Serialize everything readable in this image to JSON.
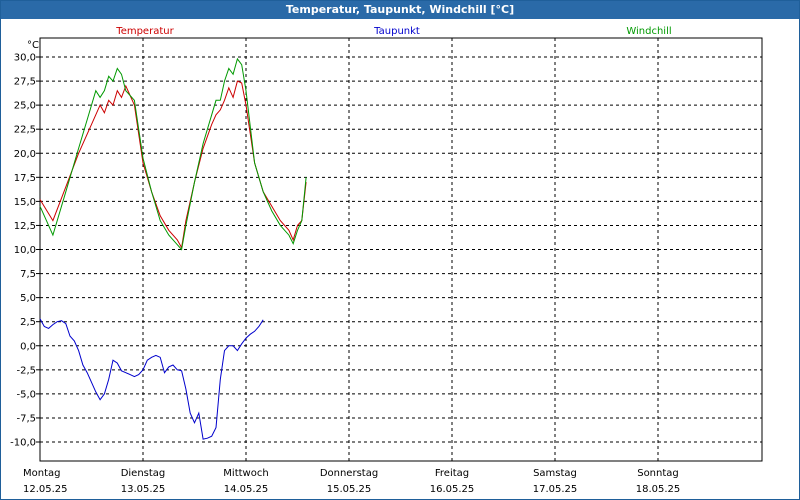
{
  "window": {
    "title": "Temperatur, Taupunkt, Windchill [°C]"
  },
  "chart_data": {
    "type": "line",
    "title": "Temperatur, Taupunkt, Windchill [°C]",
    "yunit": "°C",
    "ylim": [
      -12.5,
      32.5
    ],
    "yticks": [
      "30,0",
      "27,5",
      "25,0",
      "22,5",
      "20,0",
      "17,5",
      "15,0",
      "12,5",
      "10,0",
      "7,5",
      "5,0",
      "2,5",
      "0,0",
      "-2,5",
      "-5,0",
      "-7,5",
      "-10,0"
    ],
    "grid": true,
    "day_labels": [
      {
        "day": "Montag",
        "date": "12.05.25"
      },
      {
        "day": "Dienstag",
        "date": "13.05.25"
      },
      {
        "day": "Mittwoch",
        "date": "14.05.25"
      },
      {
        "day": "Donnerstag",
        "date": "15.05.25"
      },
      {
        "day": "Freitag",
        "date": "16.05.25"
      },
      {
        "day": "Samstag",
        "date": "17.05.25"
      },
      {
        "day": "Sonntag",
        "date": "18.05.25"
      }
    ],
    "series": [
      {
        "name": "Temperatur",
        "color": "#cc0000",
        "points": [
          [
            0,
            15.2
          ],
          [
            3,
            13.0
          ],
          [
            6,
            16.5
          ],
          [
            9,
            20.0
          ],
          [
            12,
            23.0
          ],
          [
            14,
            25.0
          ],
          [
            15,
            24.2
          ],
          [
            16,
            25.5
          ],
          [
            17,
            25.0
          ],
          [
            18,
            26.5
          ],
          [
            19,
            25.8
          ],
          [
            20,
            27.0
          ],
          [
            21,
            26.0
          ],
          [
            22,
            25.0
          ],
          [
            23,
            22.0
          ],
          [
            24,
            19.0
          ],
          [
            26,
            16.0
          ],
          [
            28,
            13.5
          ],
          [
            30,
            12.0
          ],
          [
            32,
            11.0
          ],
          [
            33,
            10.2
          ],
          [
            34,
            13.0
          ],
          [
            36,
            17.0
          ],
          [
            38,
            20.5
          ],
          [
            40,
            23.0
          ],
          [
            41,
            24.0
          ],
          [
            42,
            24.5
          ],
          [
            43,
            25.5
          ],
          [
            44,
            26.8
          ],
          [
            45,
            25.8
          ],
          [
            46,
            27.5
          ],
          [
            47,
            27.3
          ],
          [
            48,
            25.0
          ],
          [
            50,
            19.0
          ],
          [
            52,
            16.0
          ],
          [
            54,
            14.5
          ],
          [
            56,
            13.0
          ],
          [
            58,
            12.0
          ],
          [
            59,
            11.0
          ],
          [
            60,
            12.5
          ],
          [
            61,
            13.0
          ],
          [
            62,
            17.0
          ]
        ]
      },
      {
        "name": "Taupunkt",
        "color": "#0000cc",
        "points": [
          [
            0,
            2.8
          ],
          [
            1,
            2.0
          ],
          [
            2,
            1.8
          ],
          [
            3,
            2.2
          ],
          [
            4,
            2.5
          ],
          [
            5,
            2.6
          ],
          [
            6,
            2.3
          ],
          [
            7,
            1.0
          ],
          [
            8,
            0.5
          ],
          [
            9,
            -0.5
          ],
          [
            10,
            -2.0
          ],
          [
            11,
            -2.8
          ],
          [
            12,
            -3.8
          ],
          [
            13,
            -4.8
          ],
          [
            14,
            -5.6
          ],
          [
            15,
            -5.0
          ],
          [
            16,
            -3.5
          ],
          [
            17,
            -1.5
          ],
          [
            18,
            -1.8
          ],
          [
            19,
            -2.6
          ],
          [
            20,
            -2.8
          ],
          [
            21,
            -3.0
          ],
          [
            22,
            -3.2
          ],
          [
            23,
            -3.0
          ],
          [
            24,
            -2.5
          ],
          [
            25,
            -1.5
          ],
          [
            26,
            -1.2
          ],
          [
            27,
            -1.0
          ],
          [
            28,
            -1.2
          ],
          [
            29,
            -2.8
          ],
          [
            30,
            -2.2
          ],
          [
            31,
            -2.0
          ],
          [
            32,
            -2.5
          ],
          [
            33,
            -2.6
          ],
          [
            34,
            -4.5
          ],
          [
            35,
            -7.0
          ],
          [
            36,
            -8.0
          ],
          [
            37,
            -7.0
          ],
          [
            38,
            -9.7
          ],
          [
            39,
            -9.6
          ],
          [
            40,
            -9.4
          ],
          [
            41,
            -8.5
          ],
          [
            42,
            -3.5
          ],
          [
            43,
            -0.5
          ],
          [
            44,
            0.0
          ],
          [
            45,
            0.0
          ],
          [
            46,
            -0.5
          ],
          [
            47,
            0.2
          ],
          [
            48,
            0.8
          ],
          [
            49,
            1.2
          ],
          [
            50,
            1.5
          ],
          [
            51,
            2.0
          ],
          [
            52,
            2.7
          ]
        ]
      },
      {
        "name": "Windchill",
        "color": "#009900",
        "points": [
          [
            0,
            14.5
          ],
          [
            3,
            11.5
          ],
          [
            6,
            16.0
          ],
          [
            9,
            20.5
          ],
          [
            11,
            23.5
          ],
          [
            13,
            26.5
          ],
          [
            14,
            25.8
          ],
          [
            15,
            26.5
          ],
          [
            16,
            28.0
          ],
          [
            17,
            27.5
          ],
          [
            18,
            28.8
          ],
          [
            19,
            28.2
          ],
          [
            20,
            26.5
          ],
          [
            21,
            26.0
          ],
          [
            22,
            25.5
          ],
          [
            23,
            22.5
          ],
          [
            24,
            19.5
          ],
          [
            26,
            16.0
          ],
          [
            28,
            13.0
          ],
          [
            30,
            11.5
          ],
          [
            32,
            10.5
          ],
          [
            33,
            10.0
          ],
          [
            34,
            12.5
          ],
          [
            36,
            17.0
          ],
          [
            38,
            21.0
          ],
          [
            40,
            24.0
          ],
          [
            41,
            25.5
          ],
          [
            42,
            25.5
          ],
          [
            43,
            27.5
          ],
          [
            44,
            28.8
          ],
          [
            45,
            28.2
          ],
          [
            46,
            29.8
          ],
          [
            47,
            29.2
          ],
          [
            48,
            26.5
          ],
          [
            50,
            19.0
          ],
          [
            52,
            16.0
          ],
          [
            54,
            14.0
          ],
          [
            56,
            12.5
          ],
          [
            58,
            11.5
          ],
          [
            59,
            10.6
          ],
          [
            60,
            12.0
          ],
          [
            61,
            13.0
          ],
          [
            62,
            17.5
          ]
        ]
      }
    ]
  }
}
